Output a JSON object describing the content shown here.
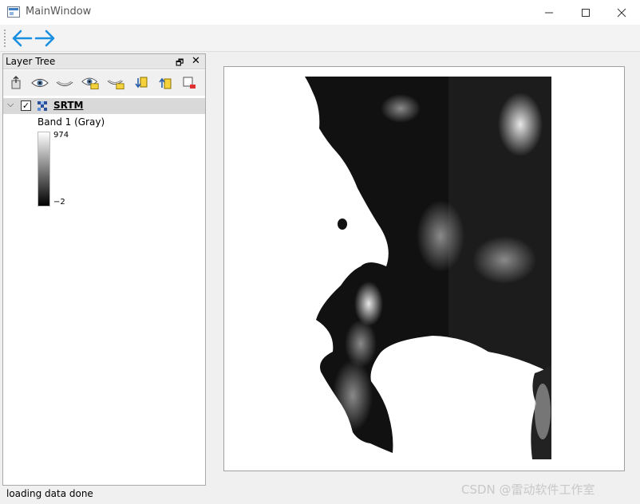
{
  "window": {
    "title": "MainWindow"
  },
  "toolbar": {
    "back_icon": "arrow-left-icon",
    "forward_icon": "arrow-right-icon",
    "accent": "#1a8fe0"
  },
  "layer_tree": {
    "title": "Layer Tree",
    "tools": [
      "zoom-to-layer-icon",
      "show-all-icon",
      "hide-all-icon",
      "show-layers-icon",
      "hide-layers-icon",
      "move-down-icon",
      "move-up-icon",
      "remove-layer-icon"
    ],
    "layer": {
      "name": "SRTM",
      "checked": true,
      "band": "Band 1 (Gray)",
      "max": "974",
      "min": "−2"
    }
  },
  "status": {
    "text": "loading data done"
  },
  "watermark": "CSDN @雷动软件工作室"
}
